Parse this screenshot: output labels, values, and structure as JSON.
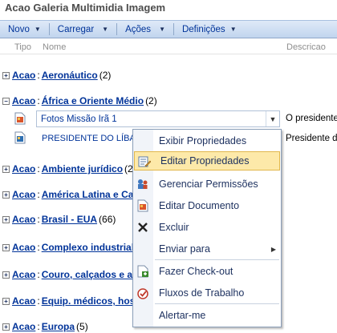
{
  "title": "Acao Galeria Multimidia Imagem",
  "toolbar": {
    "items": [
      {
        "label": "Novo"
      },
      {
        "label": "Carregar"
      },
      {
        "label": "Ações"
      },
      {
        "label": "Definições"
      }
    ]
  },
  "columns": {
    "tipo": "Tipo",
    "nome": "Nome",
    "descricao": "Descricao"
  },
  "groups": [
    {
      "prefix": "Acao",
      "name": "Aeronáutico ",
      "count": "(2)"
    },
    {
      "prefix": "Acao",
      "name": "África e Oriente Médio",
      "count": "(2)"
    },
    {
      "prefix": "Acao",
      "name": "Ambiente jurídico",
      "count": "(2"
    },
    {
      "prefix": "Acao",
      "name": "América Latina e Ca",
      "count": ""
    },
    {
      "prefix": "Acao",
      "name": "Brasil - EUA",
      "count": "(66)"
    },
    {
      "prefix": "Acao",
      "name": "Complexo industrial",
      "count": ""
    },
    {
      "prefix": "Acao",
      "name": "Couro, calçados e ar",
      "count": ""
    },
    {
      "prefix": "Acao",
      "name": "Equip. médicos, hosp",
      "count": ""
    },
    {
      "prefix": "Acao",
      "name": "Europa",
      "count": "(5)"
    }
  ],
  "items": [
    {
      "name": "Fotos Missão Irã 1",
      "description": "O presidente"
    },
    {
      "name": "PRESIDENTE DO LÍBAN",
      "description": "Presidente do"
    }
  ],
  "menu": {
    "items": [
      {
        "label": "Exibir Propriedades",
        "icon": "view-properties-icon"
      },
      {
        "label": "Editar Propriedades",
        "icon": "edit-properties-icon"
      },
      {
        "label": "Gerenciar Permissões",
        "icon": "manage-permissions-icon"
      },
      {
        "label": "Editar Documento",
        "icon": "edit-document-icon"
      },
      {
        "label": "Excluir",
        "icon": "delete-icon"
      },
      {
        "label": "Enviar para",
        "icon": "send-to-icon"
      },
      {
        "label": "Fazer Check-out",
        "icon": "check-out-icon"
      },
      {
        "label": "Fluxos de Trabalho",
        "icon": "workflows-icon"
      },
      {
        "label": "Alertar-me",
        "icon": "alert-me-icon"
      }
    ],
    "highlighted": "Editar Propriedades"
  },
  "colors": {
    "link": "#003399",
    "highlight": "#fde9a9",
    "toolbar": "#c1d5ee"
  }
}
